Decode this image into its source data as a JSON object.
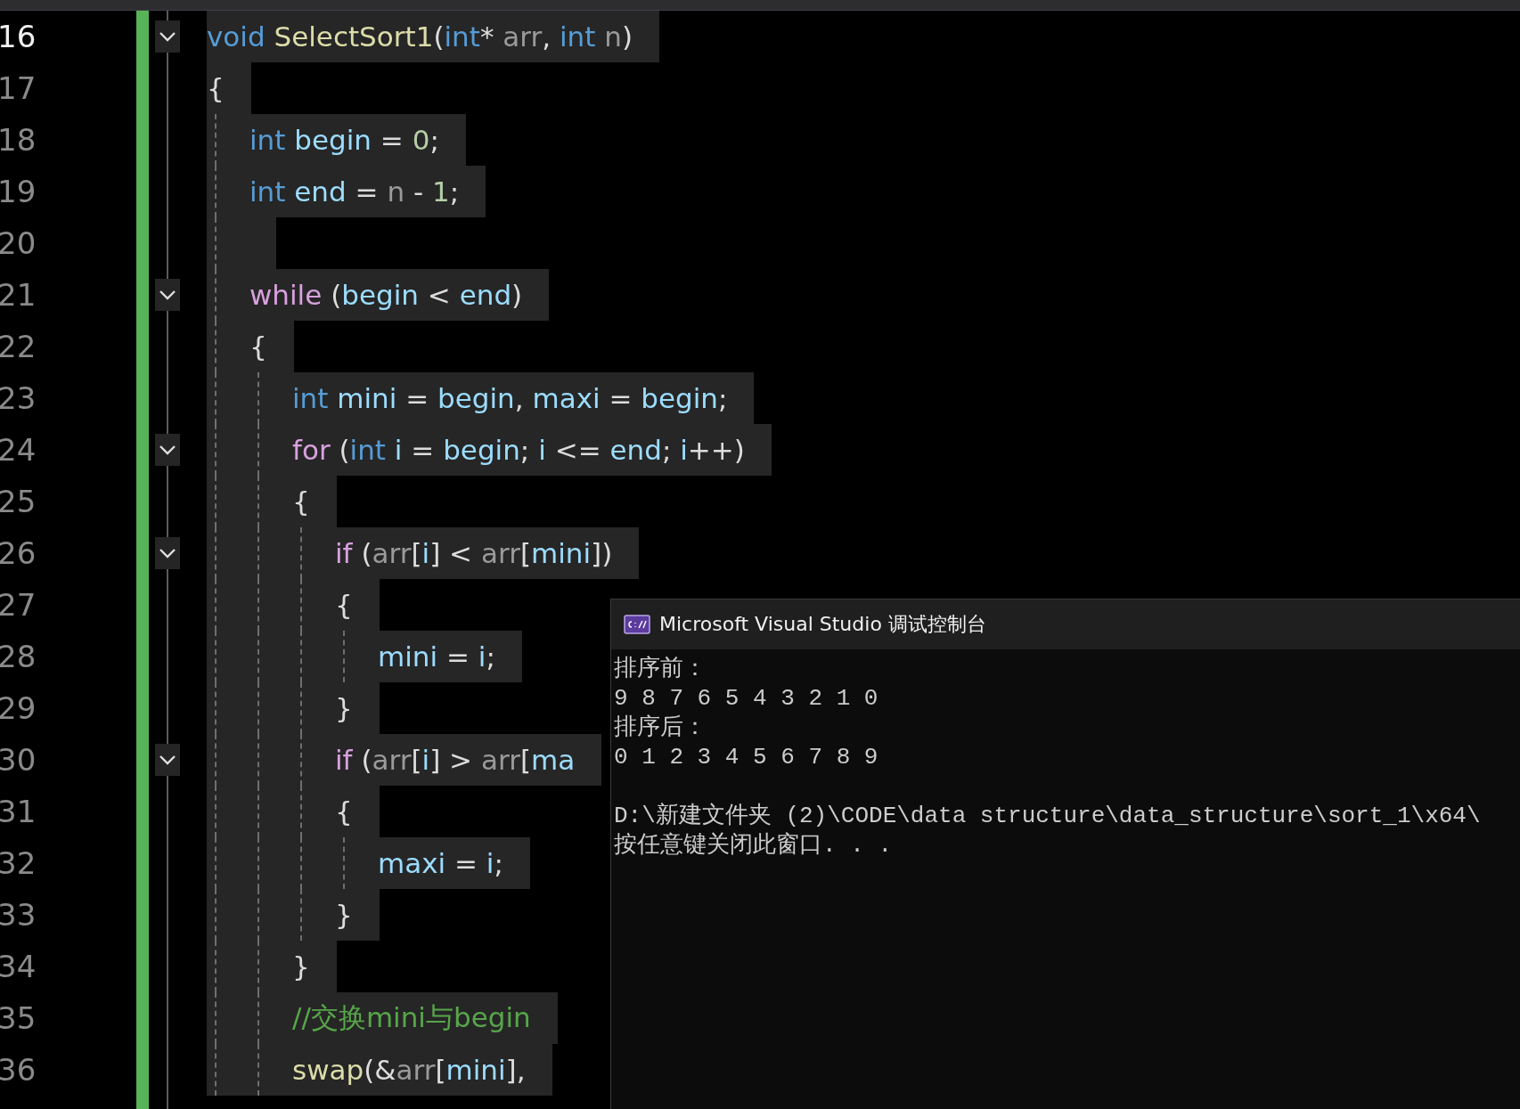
{
  "editor": {
    "lines": [
      {
        "number": "16",
        "current": true,
        "expanded": true,
        "tokens": [
          {
            "kind": "kw",
            "text": "void"
          },
          {
            "kind": "fn",
            "text": " SelectSort1"
          },
          {
            "kind": "pl",
            "text": "("
          },
          {
            "kind": "kw",
            "text": "int"
          },
          {
            "kind": "pl",
            "text": "* "
          },
          {
            "kind": "pa",
            "text": "arr"
          },
          {
            "kind": "pl",
            "text": ", "
          },
          {
            "kind": "kw",
            "text": "int"
          },
          {
            "kind": "pa",
            "text": " n"
          },
          {
            "kind": "pl",
            "text": ")"
          }
        ]
      },
      {
        "number": "17",
        "current": false,
        "tokens": [
          {
            "kind": "pl",
            "text": "{"
          }
        ],
        "children": [
          {
            "number": "18",
            "current": false,
            "tokens": [
              {
                "kind": "kw",
                "text": "int"
              },
              {
                "kind": "var",
                "text": " begin"
              },
              {
                "kind": "pl",
                "text": " = "
              },
              {
                "kind": "num",
                "text": "0"
              },
              {
                "kind": "pl",
                "text": ";"
              }
            ]
          },
          {
            "number": "19",
            "current": false,
            "tokens": [
              {
                "kind": "kw",
                "text": "int"
              },
              {
                "kind": "var",
                "text": " end"
              },
              {
                "kind": "pl",
                "text": " = "
              },
              {
                "kind": "pa",
                "text": "n"
              },
              {
                "kind": "pl",
                "text": " - "
              },
              {
                "kind": "num",
                "text": "1"
              },
              {
                "kind": "pl",
                "text": ";"
              }
            ]
          },
          {
            "number": "20",
            "current": false
          },
          {
            "number": "21",
            "current": false,
            "expanded": true,
            "tokens": [
              {
                "kind": "ctl",
                "text": "while"
              },
              {
                "kind": "pl",
                "text": " ("
              },
              {
                "kind": "var",
                "text": "begin"
              },
              {
                "kind": "pl",
                "text": " < "
              },
              {
                "kind": "var",
                "text": "end"
              },
              {
                "kind": "pl",
                "text": ")"
              }
            ]
          },
          {
            "number": "22",
            "current": false,
            "tokens": [
              {
                "kind": "pl",
                "text": "{"
              }
            ],
            "children": [
              {
                "number": "23",
                "current": false,
                "tokens": [
                  {
                    "kind": "kw",
                    "text": "int"
                  },
                  {
                    "kind": "var",
                    "text": " mini"
                  },
                  {
                    "kind": "pl",
                    "text": " = "
                  },
                  {
                    "kind": "var",
                    "text": "begin"
                  },
                  {
                    "kind": "pl",
                    "text": ", "
                  },
                  {
                    "kind": "var",
                    "text": "maxi"
                  },
                  {
                    "kind": "pl",
                    "text": " = "
                  },
                  {
                    "kind": "var",
                    "text": "begin"
                  },
                  {
                    "kind": "pl",
                    "text": ";"
                  }
                ]
              },
              {
                "number": "24",
                "current": false,
                "expanded": true,
                "tokens": [
                  {
                    "kind": "ctl",
                    "text": "for"
                  },
                  {
                    "kind": "pl",
                    "text": " ("
                  },
                  {
                    "kind": "kw",
                    "text": "int"
                  },
                  {
                    "kind": "var",
                    "text": " i"
                  },
                  {
                    "kind": "pl",
                    "text": " = "
                  },
                  {
                    "kind": "var",
                    "text": "begin"
                  },
                  {
                    "kind": "pl",
                    "text": "; "
                  },
                  {
                    "kind": "var",
                    "text": "i"
                  },
                  {
                    "kind": "pl",
                    "text": " <= "
                  },
                  {
                    "kind": "var",
                    "text": "end"
                  },
                  {
                    "kind": "pl",
                    "text": "; "
                  },
                  {
                    "kind": "var",
                    "text": "i"
                  },
                  {
                    "kind": "pl",
                    "text": "++)"
                  }
                ]
              },
              {
                "number": "25",
                "current": false,
                "tokens": [
                  {
                    "kind": "pl",
                    "text": "{"
                  }
                ],
                "children": [
                  {
                    "number": "26",
                    "current": false,
                    "expanded": true,
                    "tokens": [
                      {
                        "kind": "ctl",
                        "text": "if"
                      },
                      {
                        "kind": "pl",
                        "text": " ("
                      },
                      {
                        "kind": "pa",
                        "text": "arr"
                      },
                      {
                        "kind": "pl",
                        "text": "["
                      },
                      {
                        "kind": "var",
                        "text": "i"
                      },
                      {
                        "kind": "pl",
                        "text": "] < "
                      },
                      {
                        "kind": "pa",
                        "text": "arr"
                      },
                      {
                        "kind": "pl",
                        "text": "["
                      },
                      {
                        "kind": "var",
                        "text": "mini"
                      },
                      {
                        "kind": "pl",
                        "text": "])"
                      }
                    ]
                  },
                  {
                    "number": "27",
                    "current": false,
                    "tokens": [
                      {
                        "kind": "pl",
                        "text": "{"
                      }
                    ],
                    "children": [
                      {
                        "number": "28",
                        "current": false,
                        "tokens": [
                          {
                            "kind": "var",
                            "text": "mini"
                          },
                          {
                            "kind": "pl",
                            "text": " = "
                          },
                          {
                            "kind": "var",
                            "text": "i"
                          },
                          {
                            "kind": "pl",
                            "text": ";"
                          }
                        ]
                      }
                    ]
                  },
                  {
                    "number": "29",
                    "current": false,
                    "tokens": [
                      {
                        "kind": "pl",
                        "text": "}"
                      }
                    ]
                  },
                  {
                    "number": "30",
                    "current": false,
                    "expanded": true,
                    "tokens": [
                      {
                        "kind": "ctl",
                        "text": "if"
                      },
                      {
                        "kind": "pl",
                        "text": " ("
                      },
                      {
                        "kind": "pa",
                        "text": "arr"
                      },
                      {
                        "kind": "pl",
                        "text": "["
                      },
                      {
                        "kind": "var",
                        "text": "i"
                      },
                      {
                        "kind": "pl",
                        "text": "] > "
                      },
                      {
                        "kind": "pa",
                        "text": "arr"
                      },
                      {
                        "kind": "pl",
                        "text": "["
                      },
                      {
                        "kind": "var",
                        "text": "ma"
                      }
                    ]
                  },
                  {
                    "number": "31",
                    "current": false,
                    "tokens": [
                      {
                        "kind": "pl",
                        "text": "{"
                      }
                    ],
                    "children": [
                      {
                        "number": "32",
                        "current": false,
                        "tokens": [
                          {
                            "kind": "var",
                            "text": "maxi"
                          },
                          {
                            "kind": "pl",
                            "text": " = "
                          },
                          {
                            "kind": "var",
                            "text": "i"
                          },
                          {
                            "kind": "pl",
                            "text": ";"
                          }
                        ]
                      }
                    ]
                  },
                  {
                    "number": "33",
                    "current": false,
                    "tokens": [
                      {
                        "kind": "pl",
                        "text": "}"
                      }
                    ]
                  }
                ]
              },
              {
                "number": "34",
                "current": false,
                "tokens": [
                  {
                    "kind": "pl",
                    "text": "}"
                  }
                ]
              },
              {
                "number": "35",
                "current": false,
                "tokens": [
                  {
                    "kind": "cm",
                    "text": "//交换mini与begin"
                  }
                ]
              },
              {
                "number": "36",
                "current": false,
                "tokens": [
                  {
                    "kind": "fn",
                    "text": "swap"
                  },
                  {
                    "kind": "pl",
                    "text": "(&"
                  },
                  {
                    "kind": "pa",
                    "text": "arr"
                  },
                  {
                    "kind": "pl",
                    "text": "["
                  },
                  {
                    "kind": "var",
                    "text": "mini"
                  },
                  {
                    "kind": "pl",
                    "text": "],"
                  }
                ]
              }
            ]
          }
        ]
      }
    ]
  },
  "console": {
    "title": "Microsoft Visual Studio 调试控制台",
    "paragraphs": [
      {
        "lines": [
          "排序前：",
          "9 8 7 6 5 4 3 2 1 0",
          "排序后：",
          "0 1 2 3 4 5 6 7 8 9"
        ]
      },
      {
        "lines": [
          "D:\\新建文件夹 (2)\\CODE\\data structure\\data_structure\\sort_1\\x64\\",
          "按任意键关闭此窗口. . ."
        ]
      }
    ]
  }
}
